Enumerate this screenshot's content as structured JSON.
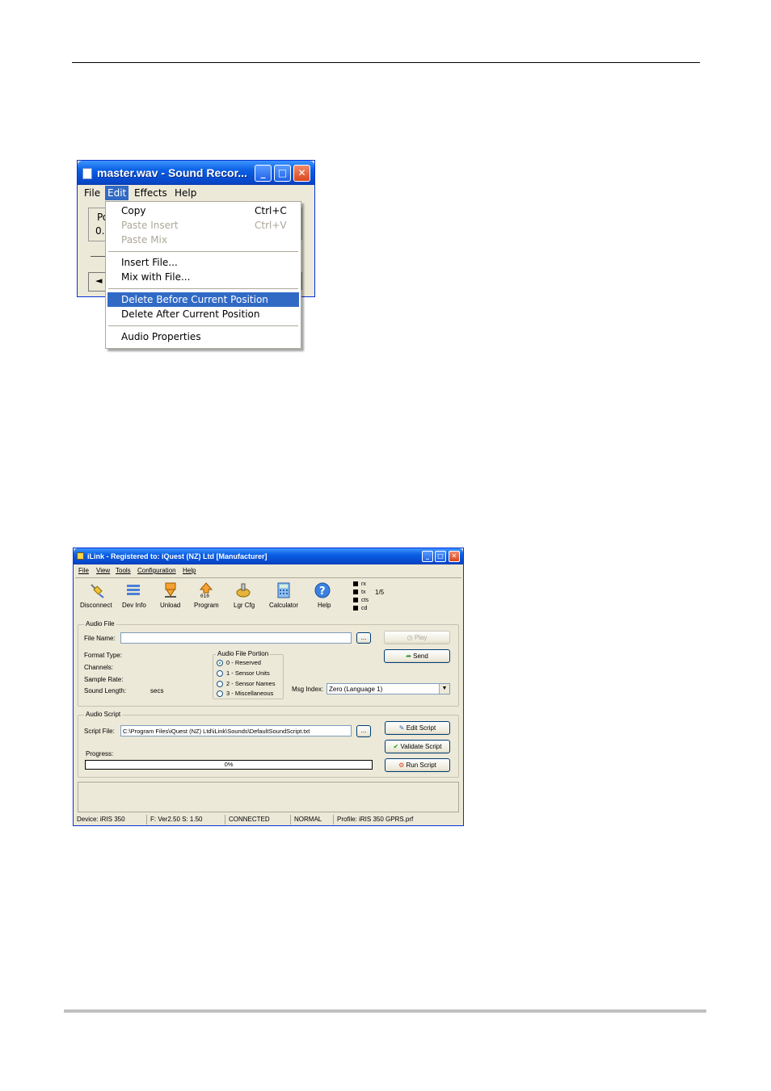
{
  "sound_recorder": {
    "title": "master.wav - Sound Recor...",
    "menus": [
      "File",
      "Edit",
      "Effects",
      "Help"
    ],
    "active_menu": "Edit",
    "body_fragments": [
      "Po",
      "0.9"
    ],
    "play_back_glyph": "◄",
    "edit_menu": {
      "items": [
        {
          "label": "Copy",
          "shortcut": "Ctrl+C",
          "state": "enabled"
        },
        {
          "label": "Paste Insert",
          "shortcut": "Ctrl+V",
          "state": "disabled"
        },
        {
          "label": "Paste Mix",
          "shortcut": "",
          "state": "disabled"
        },
        {
          "label": "Insert File...",
          "shortcut": "",
          "state": "enabled"
        },
        {
          "label": "Mix with File...",
          "shortcut": "",
          "state": "enabled"
        },
        {
          "label": "Delete Before Current Position",
          "shortcut": "",
          "state": "highlighted"
        },
        {
          "label": "Delete After Current Position",
          "shortcut": "",
          "state": "enabled"
        },
        {
          "label": "Audio Properties",
          "shortcut": "",
          "state": "enabled"
        }
      ]
    }
  },
  "ilink": {
    "title": "iLink - Registered to: iQuest (NZ) Ltd [Manufacturer]",
    "menus": [
      "File",
      "View",
      "Tools",
      "Configuration",
      "Help"
    ],
    "toolbar": [
      {
        "label": "Disconnect",
        "icon": "disconnect-plug-icon"
      },
      {
        "label": "Dev Info",
        "icon": "device-info-icon"
      },
      {
        "label": "Unload",
        "icon": "unload-arrow-icon"
      },
      {
        "label": "Program",
        "icon": "program-arrow-icon"
      },
      {
        "label": "Lgr Cfg",
        "icon": "logger-config-icon"
      },
      {
        "label": "Calculator",
        "icon": "calculator-icon"
      },
      {
        "label": "Help",
        "icon": "help-icon"
      }
    ],
    "leds": [
      "rx",
      "tx",
      "cts",
      "cd"
    ],
    "led_counter": "1/5",
    "audio_file": {
      "group_title": "Audio File",
      "file_name_label": "File Name:",
      "file_name_value": "",
      "browse_label": "...",
      "play_label": "Play",
      "send_label": "Send",
      "format_type_label": "Format Type:",
      "channels_label": "Channels:",
      "sample_rate_label": "Sample Rate:",
      "sound_length_label": "Sound Length:",
      "sound_length_unit": "secs",
      "portion_title": "Audio File Portion",
      "portions": [
        {
          "label": "0 - Reserved",
          "selected": true
        },
        {
          "label": "1 - Sensor Units",
          "selected": false
        },
        {
          "label": "2 - Sensor Names",
          "selected": false
        },
        {
          "label": "3 - Miscellaneous",
          "selected": false
        }
      ],
      "msg_index_label": "Msg Index:",
      "msg_index_value": "Zero (Language 1)"
    },
    "audio_script": {
      "group_title": "Audio Script",
      "script_file_label": "Script File:",
      "script_file_value": "C:\\Program Files\\iQuest (NZ) Ltd\\iLink\\Sounds\\DefaultSoundScript.txt",
      "browse_label": "...",
      "edit_label": "Edit Script",
      "validate_label": "Validate Script",
      "run_label": "Run Script",
      "progress_label": "Progress:",
      "progress_text": "0%",
      "progress_value": 0
    },
    "status_bar": [
      "Device: iRIS 350",
      "F: Ver2.50 S: 1.50",
      "CONNECTED",
      "NORMAL",
      "Profile: iRIS 350 GPRS.prf"
    ]
  }
}
